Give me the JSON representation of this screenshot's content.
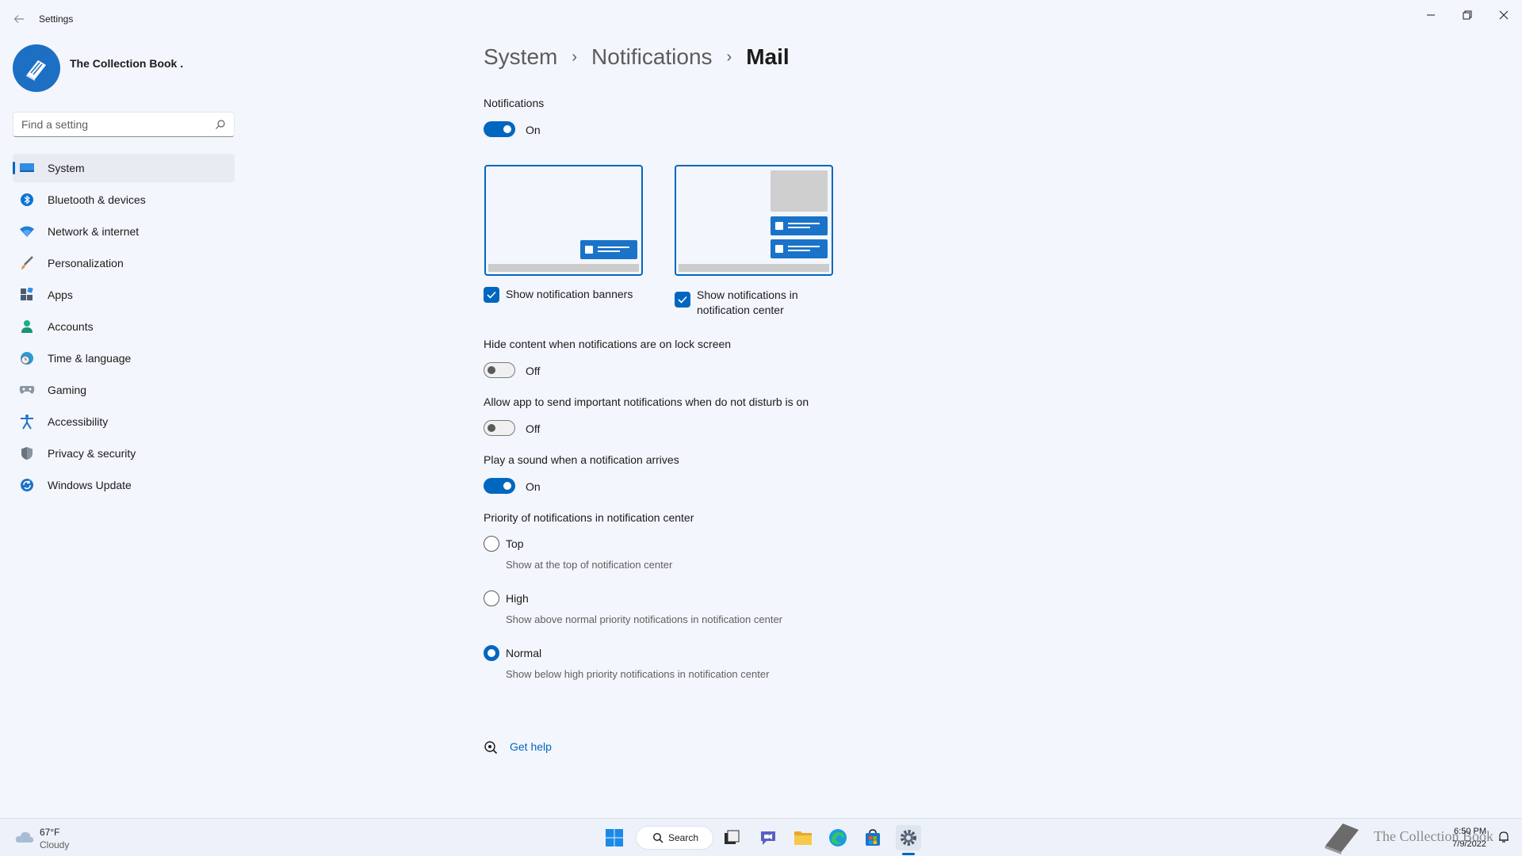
{
  "window": {
    "title": "Settings"
  },
  "profile": {
    "name": "The Collection Book ."
  },
  "search": {
    "placeholder": "Find a setting"
  },
  "sidebar": {
    "items": [
      {
        "label": "System",
        "icon": "system-icon",
        "active": true
      },
      {
        "label": "Bluetooth & devices",
        "icon": "bluetooth-icon"
      },
      {
        "label": "Network & internet",
        "icon": "wifi-icon"
      },
      {
        "label": "Personalization",
        "icon": "brush-icon"
      },
      {
        "label": "Apps",
        "icon": "apps-icon"
      },
      {
        "label": "Accounts",
        "icon": "person-icon"
      },
      {
        "label": "Time & language",
        "icon": "globe-clock-icon"
      },
      {
        "label": "Gaming",
        "icon": "gamepad-icon"
      },
      {
        "label": "Accessibility",
        "icon": "accessibility-icon"
      },
      {
        "label": "Privacy & security",
        "icon": "shield-icon"
      },
      {
        "label": "Windows Update",
        "icon": "update-icon"
      }
    ]
  },
  "breadcrumb": {
    "part1": "System",
    "part2": "Notifications",
    "current": "Mail",
    "separator": "›"
  },
  "settings": {
    "notifications": {
      "label": "Notifications",
      "state": "On"
    },
    "banners_label": "Show notification banners",
    "center_label_line1": "Show notifications in",
    "center_label_line2": "notification center",
    "hide_content": {
      "label": "Hide content when notifications are on lock screen",
      "state": "Off"
    },
    "allow_important": {
      "label": "Allow app to send important notifications when do not disturb is on",
      "state": "Off"
    },
    "play_sound": {
      "label": "Play a sound when a notification arrives",
      "state": "On"
    },
    "priority": {
      "label": "Priority of notifications in notification center",
      "options": [
        {
          "label": "Top",
          "desc": "Show at the top of notification center",
          "selected": false
        },
        {
          "label": "High",
          "desc": "Show above normal priority notifications in notification center",
          "selected": false
        },
        {
          "label": "Normal",
          "desc": "Show below high priority notifications in notification center",
          "selected": true
        }
      ]
    }
  },
  "help": {
    "label": "Get help"
  },
  "taskbar": {
    "weather_temp": "67°F",
    "weather_desc": "Cloudy",
    "search_label": "Search",
    "time": "6:50 PM",
    "date": "7/9/2022",
    "watermark": "The Collection Book"
  },
  "colors": {
    "accent": "#0067c0",
    "background": "#f3f6fc"
  }
}
